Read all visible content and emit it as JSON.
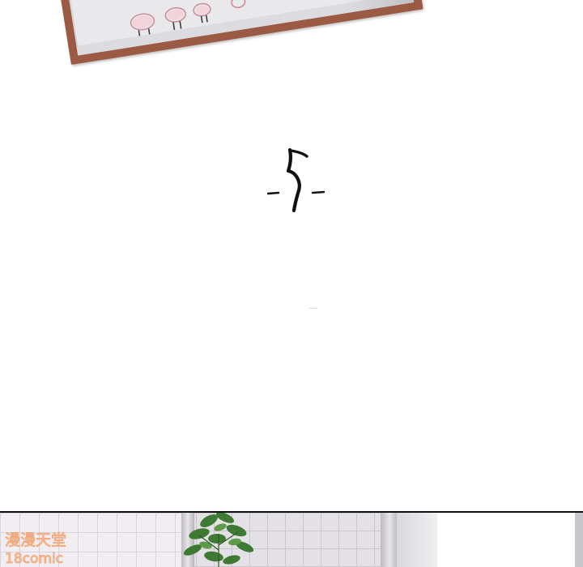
{
  "chapter": {
    "number": "5",
    "left_dash": "-",
    "right_dash": "-"
  },
  "watermark": {
    "text": "漫漫天堂",
    "sub": "18comic"
  },
  "colors": {
    "frame": "#9a5a44",
    "frame_inner": "#e9e9ec",
    "ink": "#111111",
    "tile": "#e4e1e6",
    "plant": "#3f7a34",
    "watermark": "#f0a070"
  }
}
